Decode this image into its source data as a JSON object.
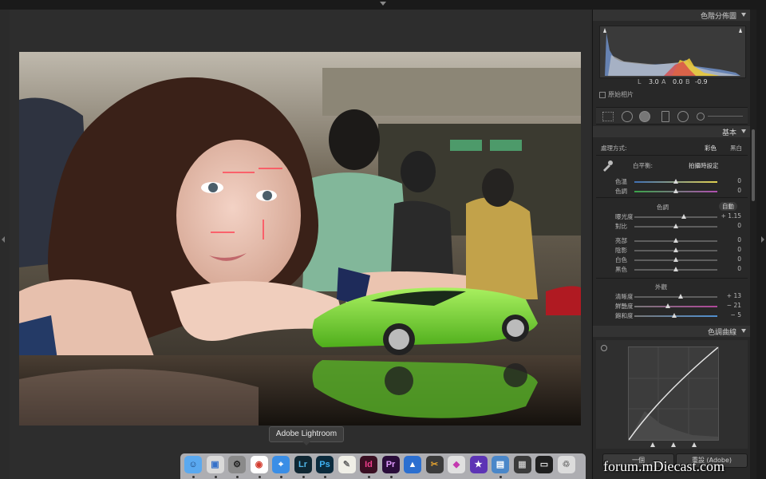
{
  "tooltip": {
    "label": "Adobe Lightroom"
  },
  "histogram": {
    "title": "色階分佈圖",
    "readout": {
      "l_label": "L",
      "l_value": "3.0",
      "a_label": "A",
      "a_value": "0.0",
      "b_label": "B",
      "b_value": "-0.9"
    },
    "original_photo_label": "原始相片"
  },
  "basic": {
    "title": "基本",
    "treatment_label": "處理方式:",
    "treatment_color": "彩色",
    "treatment_bw": "黑白",
    "wb_label": "白平衡:",
    "wb_value": "拍攝時設定",
    "sliders_wb": [
      {
        "label": "色溫",
        "value": "0",
        "pos": 0.5
      },
      {
        "label": "色調",
        "value": "0",
        "pos": 0.5
      }
    ],
    "tone_label": "色調",
    "auto_label": "自動",
    "sliders_tone": [
      {
        "label": "曝光度",
        "value": "+ 1.15",
        "pos": 0.6
      },
      {
        "label": "對比",
        "value": "0",
        "pos": 0.5
      }
    ],
    "sliders_presence_tone": [
      {
        "label": "亮部",
        "value": "0",
        "pos": 0.5
      },
      {
        "label": "陰影",
        "value": "0",
        "pos": 0.5
      },
      {
        "label": "白色",
        "value": "0",
        "pos": 0.5
      },
      {
        "label": "黑色",
        "value": "0",
        "pos": 0.5
      }
    ],
    "presence_label": "外觀",
    "sliders_presence": [
      {
        "label": "清晰度",
        "value": "+ 13",
        "pos": 0.56
      },
      {
        "label": "鮮艷度",
        "value": "− 21",
        "pos": 0.4
      },
      {
        "label": "飽和度",
        "value": "− 5",
        "pos": 0.48
      }
    ]
  },
  "tone_curve": {
    "title": "色調曲線"
  },
  "footer": {
    "prev_label": "一個",
    "reset_label": "重設 (Adobe)"
  },
  "dock": {
    "items": [
      {
        "name": "finder-icon",
        "glyph": "☺",
        "bg": "#5aa9f0",
        "fg": "#1b3f73"
      },
      {
        "name": "preview-icon",
        "glyph": "▣",
        "bg": "#d9d9d9",
        "fg": "#3470c9"
      },
      {
        "name": "system-preferences-icon",
        "glyph": "⚙",
        "bg": "#8a8a8a",
        "fg": "#222"
      },
      {
        "name": "chrome-icon",
        "glyph": "◉",
        "bg": "#ffffff",
        "fg": "#d33c2f"
      },
      {
        "name": "safari-icon",
        "glyph": "⌖",
        "bg": "#3a8ee6",
        "fg": "#fff"
      },
      {
        "name": "lightroom-icon",
        "glyph": "Lr",
        "bg": "#0f2733",
        "fg": "#4fb4e6"
      },
      {
        "name": "photoshop-icon",
        "glyph": "Ps",
        "bg": "#0b2b3d",
        "fg": "#3fb3f5"
      },
      {
        "name": "textedit-icon",
        "glyph": "✎",
        "bg": "#f0efe7",
        "fg": "#666"
      },
      {
        "name": "indesign-icon",
        "glyph": "Id",
        "bg": "#3a0f22",
        "fg": "#ee3d8b"
      },
      {
        "name": "premiere-icon",
        "glyph": "Pr",
        "bg": "#2a0d3a",
        "fg": "#e19bff"
      },
      {
        "name": "keynote-icon",
        "glyph": "▲",
        "bg": "#2b6fd0",
        "fg": "#fff"
      },
      {
        "name": "final-cut-icon",
        "glyph": "✂",
        "bg": "#3b3b3b",
        "fg": "#e0a030"
      },
      {
        "name": "pixelmator-icon",
        "glyph": "◆",
        "bg": "#e0e0e0",
        "fg": "#c43ab0"
      },
      {
        "name": "imovie-icon",
        "glyph": "★",
        "bg": "#5d34b5",
        "fg": "#fff"
      },
      {
        "name": "image-capture-icon",
        "glyph": "▤",
        "bg": "#4a87c9",
        "fg": "#fff"
      },
      {
        "name": "photos-folder-icon",
        "glyph": "▦",
        "bg": "#3b3b3b",
        "fg": "#bbb"
      },
      {
        "name": "screen-capture-icon",
        "glyph": "▭",
        "bg": "#1f1f1f",
        "fg": "#ddd"
      },
      {
        "name": "trash-icon",
        "glyph": "♲",
        "bg": "#dcdcdc",
        "fg": "#777"
      }
    ]
  },
  "watermark": {
    "text": "forum.mDiecast.com"
  }
}
